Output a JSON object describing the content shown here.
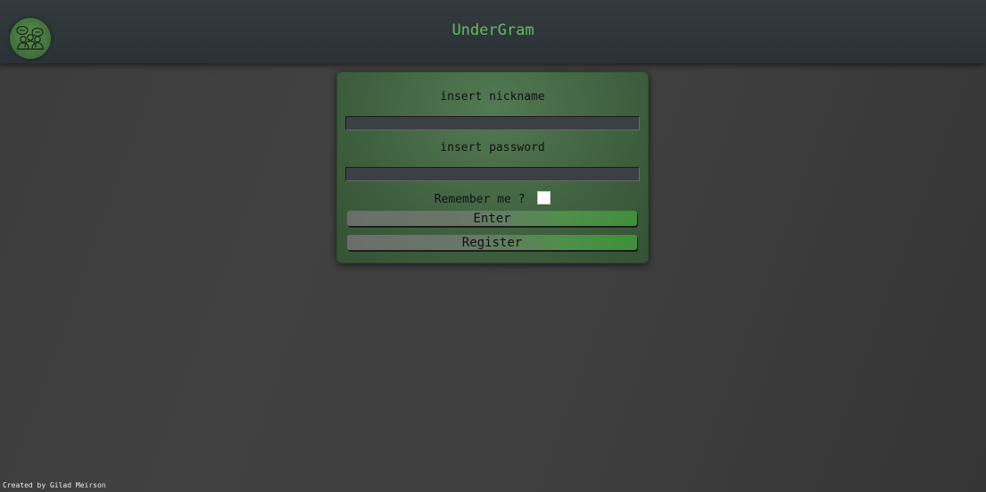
{
  "header": {
    "title": "UnderGram",
    "logo_icon": "group-chat-icon"
  },
  "login": {
    "nickname_label": "insert nickname",
    "nickname_value": "",
    "password_label": "insert password",
    "password_value": "",
    "remember_label": "Remember me ?",
    "remember_checked": false,
    "enter_label": "Enter",
    "register_label": "Register"
  },
  "footer": {
    "credit": "Created by Gilad Meirson"
  },
  "colors": {
    "title": "#5fbf5f",
    "card": "#456845",
    "button_accent": "#3f8f3a"
  }
}
